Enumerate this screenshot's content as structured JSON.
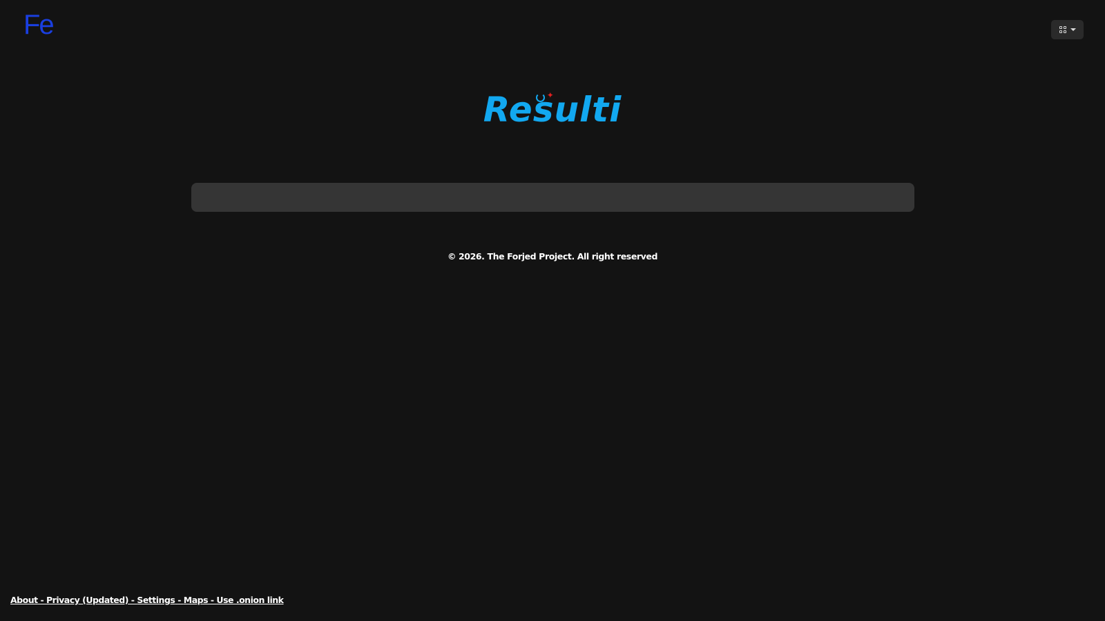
{
  "header": {
    "brand_logo_text": "Fe",
    "apps_menu_icon": "grid-icon",
    "apps_menu_chevron": "chevron-down-icon"
  },
  "hero": {
    "logo_text": "Resulti",
    "logo_accent_color": "#12a8f0",
    "logo_leaf_color": "#e02020"
  },
  "search": {
    "placeholder": "",
    "value": ""
  },
  "copyright": "© 2026. The Forjed Project. All right reserved",
  "footer": {
    "separator": " - ",
    "links": [
      "About",
      "Privacy (Updated)",
      "Settings",
      "Maps",
      "Use .onion link"
    ]
  },
  "colors": {
    "background": "#131313",
    "brand_logo": "#1a3fe0",
    "search_bg": "#353535",
    "text": "#ffffff"
  }
}
